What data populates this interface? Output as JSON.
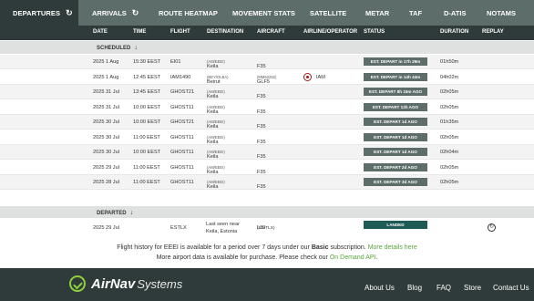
{
  "tabs": {
    "departures": "DEPARTURES",
    "arrivals": "ARRIVALS",
    "route_heatmap": "ROUTE HEATMAP",
    "movement_stats": "MOVEMENT STATS",
    "satellite": "SATELLITE",
    "metar": "METAR",
    "taf": "TAF",
    "datis": "D-ATIS",
    "notams": "NOTAMS"
  },
  "columns": {
    "date": "DATE",
    "time": "TIME",
    "flight": "FLIGHT",
    "destination": "DESTINATION",
    "aircraft": "AIRCRAFT",
    "airline": "AIRLINE/OPERATOR",
    "status": "STATUS",
    "duration": "DURATION",
    "replay": "REPLAY"
  },
  "scheduled_label": "SCHEDULED",
  "departed_label": "DEPARTED",
  "scheduled": [
    {
      "date": "2025 1 Aug",
      "time": "15:30 EEST",
      "flight": "EI01",
      "dest": "Keila",
      "dest_code": "(AM/EEEI)",
      "aircraft": "F35",
      "aircraft_code": "",
      "airline": "",
      "status": "EST. DEPART in 17h 29m",
      "duration": "01h50m"
    },
    {
      "date": "2025 1 Aug",
      "time": "12:45 EEST",
      "flight": "IAM1490",
      "dest": "Beirut",
      "dest_code": "(BEY/OLBA)",
      "aircraft": "GLF5",
      "aircraft_code": "(MM62252)",
      "airline": "IAM",
      "status": "EST. DEPART in 14h 44m",
      "duration": "04h02m"
    },
    {
      "date": "2025 31 Jul",
      "time": "13:45 EEST",
      "flight": "GHOST21",
      "dest": "Keila",
      "dest_code": "(AM/EEEI)",
      "aircraft": "F35",
      "aircraft_code": "",
      "airline": "",
      "status": "EST. DEPART 8h 15m AGO",
      "duration": "02h05m"
    },
    {
      "date": "2025 31 Jul",
      "time": "10:00 EEST",
      "flight": "GHOST11",
      "dest": "Keila",
      "dest_code": "(AM/EEEI)",
      "aircraft": "F35",
      "aircraft_code": "",
      "airline": "",
      "status": "EST. DEPART 12h AGO",
      "duration": "02h05m"
    },
    {
      "date": "2025 30 Jul",
      "time": "10:00 EEST",
      "flight": "GHOST21",
      "dest": "Keila",
      "dest_code": "(AM/EEEI)",
      "aircraft": "F35",
      "aircraft_code": "",
      "airline": "",
      "status": "EST. DEPART 1d AGO",
      "duration": "01h35m"
    },
    {
      "date": "2025 30 Jul",
      "time": "11:00 EEST",
      "flight": "GHOST11",
      "dest": "Keila",
      "dest_code": "(AM/EEEI)",
      "aircraft": "F35",
      "aircraft_code": "",
      "airline": "",
      "status": "EST. DEPART 1d AGO",
      "duration": "02h05m"
    },
    {
      "date": "2025 30 Jul",
      "time": "10:00 EEST",
      "flight": "GHOST11",
      "dest": "Keila",
      "dest_code": "(AM/EEEI)",
      "aircraft": "F35",
      "aircraft_code": "",
      "airline": "",
      "status": "EST. DEPART 1d AGO",
      "duration": "02h04m"
    },
    {
      "date": "2025 29 Jul",
      "time": "11:00 EEST",
      "flight": "GHOST11",
      "dest": "Keila",
      "dest_code": "(AM/EEEI)",
      "aircraft": "F35",
      "aircraft_code": "",
      "airline": "",
      "status": "EST. DEPART 2d AGO",
      "duration": "02h05m"
    },
    {
      "date": "2025 28 Jul",
      "time": "11:00 EEST",
      "flight": "GHOST11",
      "dest": "Keila",
      "dest_code": "(AM/EEEI)",
      "aircraft": "F35",
      "aircraft_code": "",
      "airline": "",
      "status": "EST. DEPART 3d AGO",
      "duration": "02h05m"
    }
  ],
  "departed": {
    "date": "2025 29 Jul",
    "flight": "ESTLX",
    "dest_line1": "Last seen near",
    "dest_line2": "Keila, Estonia",
    "aircraft": "L39",
    "aircraft_code": "(ES-TLX)",
    "status": "LANDED"
  },
  "info": {
    "l1_a": "Flight history for EEEI is available for a period over 7 days under our",
    "l1_bold": "Basic",
    "l1_b": "subscription.",
    "l1_link": "More details here",
    "l2_a": "More airport data is available for purchase. Please check our",
    "l2_link": "On Demand API",
    "l2_end": "."
  },
  "footer": {
    "brand": "AirNav",
    "brand_sub": "Systems",
    "links": [
      "About Us",
      "Blog",
      "FAQ",
      "Store",
      "Contact Us"
    ]
  },
  "colors": {
    "tabbar": "#5d6d6a",
    "dark": "#2f3b3a",
    "accent_green": "#5aa53a",
    "landed": "#1e5b57"
  }
}
